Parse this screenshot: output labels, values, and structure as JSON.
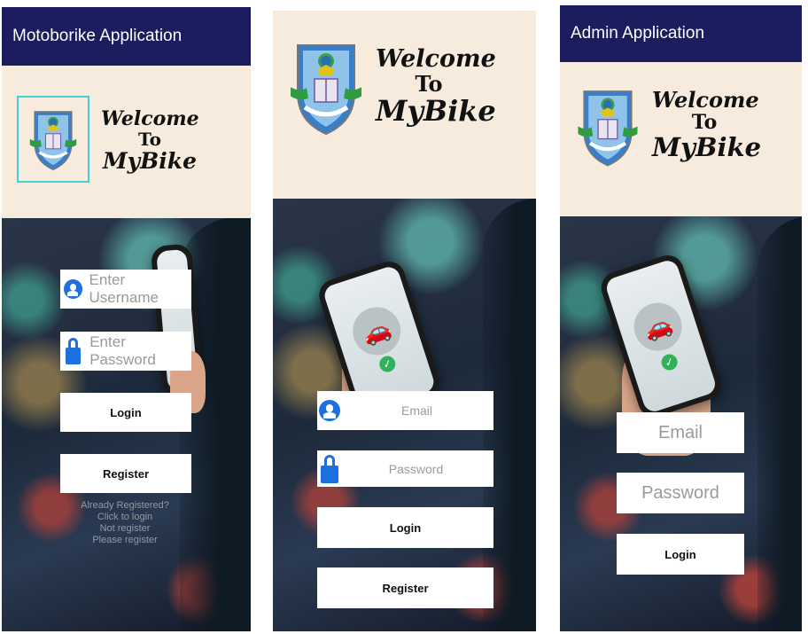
{
  "screens": {
    "left": {
      "app_title": "Motoborike Application",
      "welcome": [
        "Welcome",
        "To",
        "MyBike"
      ],
      "username_placeholder": "Enter Username",
      "password_placeholder": "Enter Password",
      "login_label": "Login",
      "register_label": "Register",
      "faded_text": [
        "Already Registered?",
        "Click to login",
        "Not register",
        "Please register"
      ]
    },
    "middle": {
      "welcome": [
        "Welcome",
        "To",
        "MyBike"
      ],
      "email_placeholder": "Email",
      "password_placeholder": "Password",
      "login_label": "Login",
      "register_label": "Register"
    },
    "right": {
      "app_title": "Admin Application",
      "welcome": [
        "Welcome",
        "To",
        "MyBike"
      ],
      "email_placeholder": "Email",
      "password_placeholder": "Password",
      "login_label": "Login"
    }
  },
  "icons": [
    "user-icon",
    "lock-icon",
    "car-icon",
    "check-icon",
    "crest-logo"
  ],
  "colors": {
    "appbar": "#1b1d5e",
    "header": "#f6ebdd",
    "field_icon": "#1e6fe0",
    "check": "#2fb35a"
  }
}
